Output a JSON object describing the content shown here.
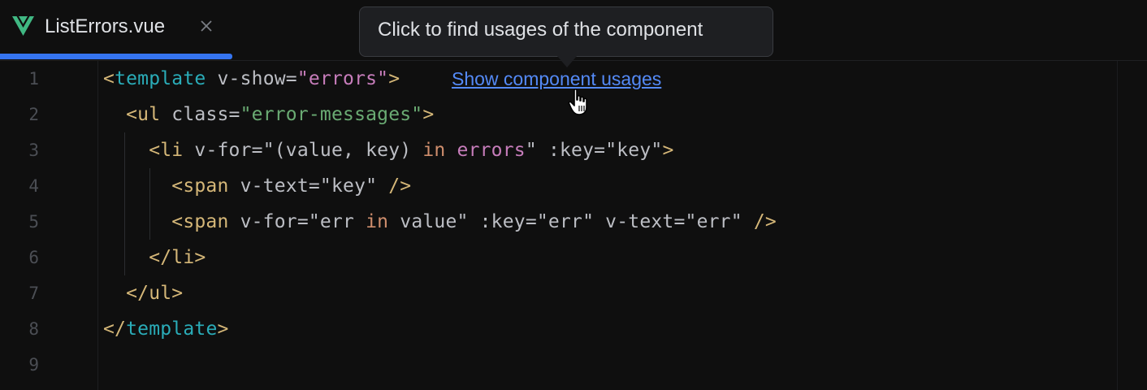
{
  "tab": {
    "file_name": "ListErrors.vue",
    "icon": "vue-logo-icon",
    "close_icon": "close-icon",
    "active_indicator_color": "#3574f0"
  },
  "tooltip": {
    "text": "Click to find usages of the component"
  },
  "inlay": {
    "link_text": "Show component usages"
  },
  "editor": {
    "line_numbers": [
      "1",
      "2",
      "3",
      "4",
      "5",
      "6",
      "7",
      "8",
      "9"
    ],
    "lines": [
      [
        {
          "t": "<",
          "c": "tag"
        },
        {
          "t": "template",
          "c": "tname"
        },
        {
          "t": " v-show=",
          "c": "attr"
        },
        {
          "t": "\"errors\"",
          "c": "strp"
        },
        {
          "t": ">",
          "c": "tag"
        }
      ],
      [
        {
          "t": "  <ul",
          "c": "tag"
        },
        {
          "t": " class=",
          "c": "attr"
        },
        {
          "t": "\"error-messages\"",
          "c": "str"
        },
        {
          "t": ">",
          "c": "tag"
        }
      ],
      [
        {
          "t": "    <li",
          "c": "tag"
        },
        {
          "t": " v-for=",
          "c": "attr"
        },
        {
          "t": "\"(value, key) ",
          "c": "ident"
        },
        {
          "t": "in",
          "c": "kw"
        },
        {
          "t": " ",
          "c": "ident"
        },
        {
          "t": "errors",
          "c": "strp"
        },
        {
          "t": "\"",
          "c": "ident"
        },
        {
          "t": " :key=",
          "c": "attr"
        },
        {
          "t": "\"key\"",
          "c": "ident"
        },
        {
          "t": ">",
          "c": "tag"
        }
      ],
      [
        {
          "t": "      <span",
          "c": "tag"
        },
        {
          "t": " v-text=",
          "c": "attr"
        },
        {
          "t": "\"key\"",
          "c": "ident"
        },
        {
          "t": " />",
          "c": "tag"
        }
      ],
      [
        {
          "t": "      <span",
          "c": "tag"
        },
        {
          "t": " v-for=",
          "c": "attr"
        },
        {
          "t": "\"err ",
          "c": "ident"
        },
        {
          "t": "in",
          "c": "kw"
        },
        {
          "t": " value\"",
          "c": "ident"
        },
        {
          "t": " :key=",
          "c": "attr"
        },
        {
          "t": "\"err\"",
          "c": "ident"
        },
        {
          "t": " v-text=",
          "c": "attr"
        },
        {
          "t": "\"err\"",
          "c": "ident"
        },
        {
          "t": " />",
          "c": "tag"
        }
      ],
      [
        {
          "t": "    </li>",
          "c": "tag"
        }
      ],
      [
        {
          "t": "  </ul>",
          "c": "tag"
        }
      ],
      [
        {
          "t": "</",
          "c": "tag"
        },
        {
          "t": "template",
          "c": "tname"
        },
        {
          "t": ">",
          "c": "tag"
        }
      ],
      []
    ]
  }
}
